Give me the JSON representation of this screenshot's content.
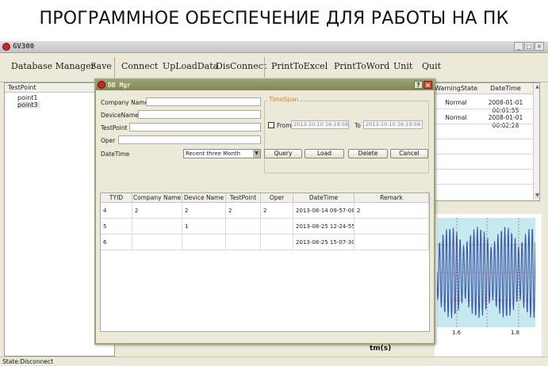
{
  "banner": {
    "text": "ПРОГРАММНОЕ ОБЕСПЕЧЕНИЕ ДЛЯ РАБОТЫ НА ПК"
  },
  "window": {
    "title": "GV300"
  },
  "menu": {
    "items": [
      "Database Manager",
      "Save",
      "Connect",
      "UpLoadData",
      "DisConnect",
      "PrintToExcel",
      "PrintToWord",
      "Unit",
      "Quit"
    ]
  },
  "left_panel": {
    "header": "TestPoint",
    "items": [
      "point1",
      "point3"
    ]
  },
  "right_table": {
    "headers": [
      "WarningState",
      "DateTime"
    ],
    "rows": [
      {
        "state": "Normal",
        "datetime": "2008-01-01 00:01:55"
      },
      {
        "state": "Normal",
        "datetime": "2008-01-01 00:02:28"
      }
    ]
  },
  "chart": {
    "xlabel": "tm(s)",
    "ticks": [
      "1.6",
      "1.8"
    ]
  },
  "status": {
    "text": "State:Disconnect"
  },
  "dialog": {
    "title": "DB Mgr",
    "fields": {
      "company_name": {
        "label": "Company Name",
        "value": ""
      },
      "device_name": {
        "label": "DeviceName",
        "value": ""
      },
      "test_point": {
        "label": "TestPoint",
        "value": ""
      },
      "oper": {
        "label": "Oper",
        "value": ""
      }
    },
    "timespan": {
      "legend": "TimeSpan",
      "from_label": "From",
      "from_value": "2013-10-10 16:19:58",
      "to_label": "To",
      "to_value": "2013-10-10 16:19:58"
    },
    "datetime_label": "DateTime",
    "datetime_select": "Recent three Month",
    "buttons": {
      "query": "Query",
      "load": "Load",
      "delete": "Delete",
      "cancel": "Cancel"
    },
    "grid": {
      "headers": [
        "TYID",
        "Company Name",
        "Device Name",
        "TestPoint",
        "Oper",
        "DateTime",
        "Remark"
      ],
      "rows": [
        [
          "4",
          "2",
          "2",
          "2",
          "2",
          "2013-08-14 09-57-08",
          "2"
        ],
        [
          "5",
          "",
          "1",
          "",
          "",
          "2013-08-25 12-24-55",
          ""
        ],
        [
          "6",
          "",
          "",
          "",
          "",
          "2013-08-25 15-07-30",
          ""
        ]
      ]
    }
  },
  "colors": {
    "accent": "#c62828",
    "plot_bg": "#c4eaf0",
    "signal": "#3a55a8",
    "grid_red": "#e23030"
  }
}
